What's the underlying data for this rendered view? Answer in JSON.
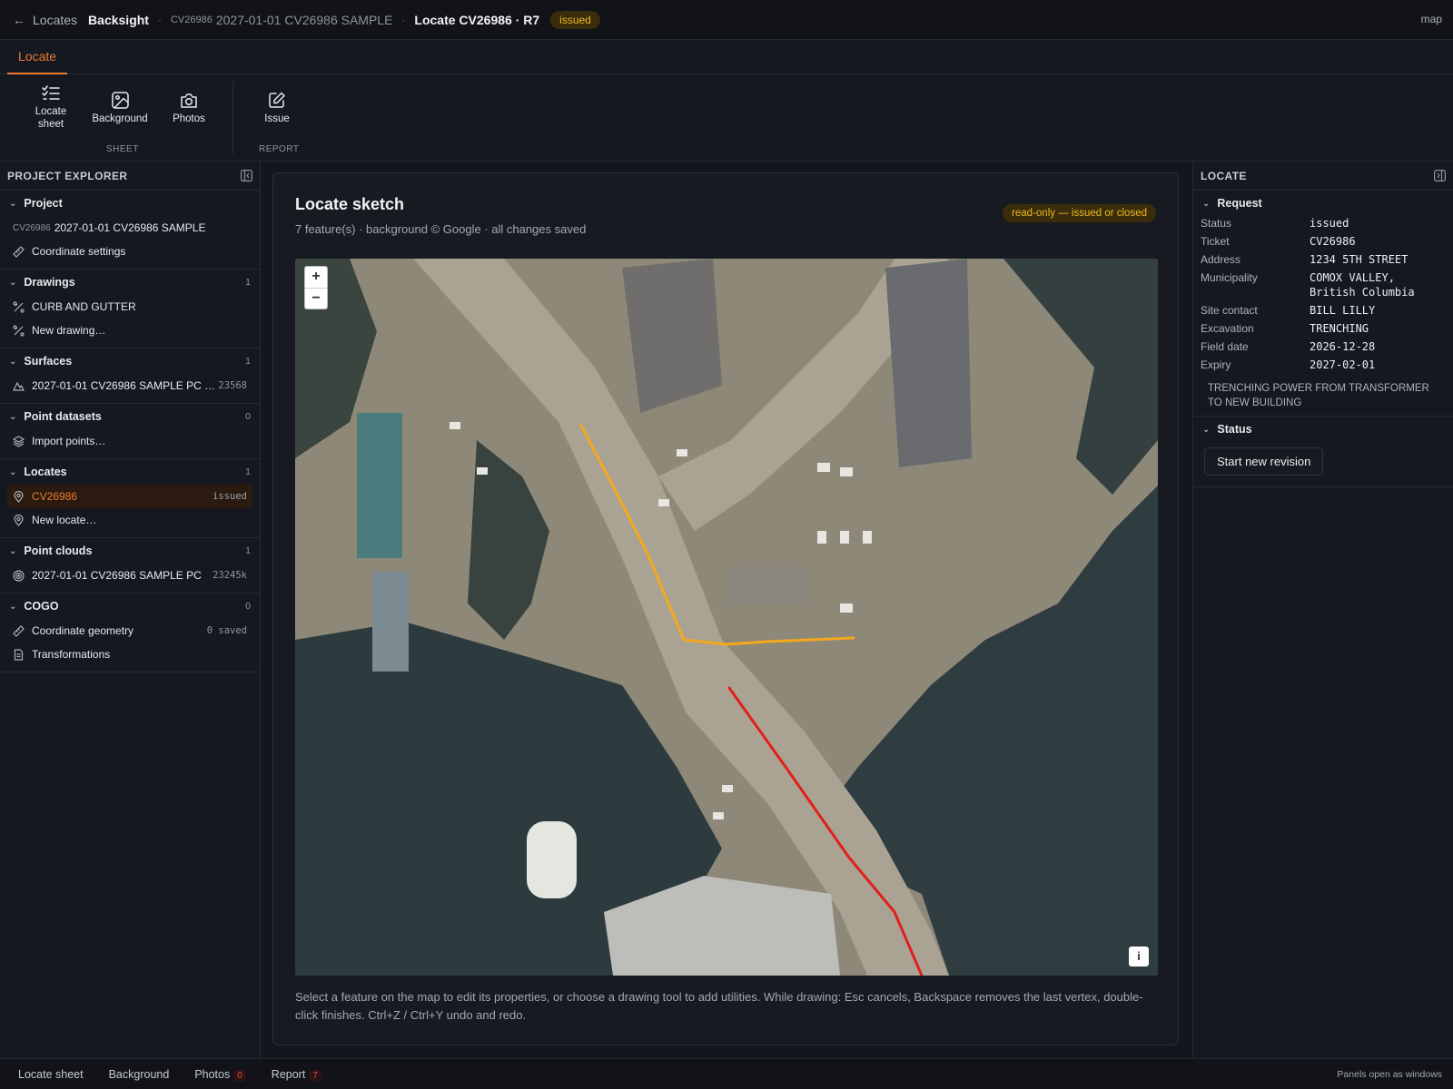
{
  "topbar": {
    "back_label": "Locates",
    "app_name": "Backsight",
    "project_id": "CV26986",
    "project_name": "2027-01-01 CV26986 SAMPLE",
    "locate_title": "Locate CV26986 · R7",
    "status_badge": "issued",
    "right_label": "map"
  },
  "ribbon": {
    "tab": "Locate",
    "buttons": {
      "locate_sheet": "Locate sheet",
      "background": "Background",
      "photos": "Photos",
      "issue": "Issue"
    },
    "groups": {
      "sheet": "SHEET",
      "report": "REPORT"
    }
  },
  "explorer": {
    "title": "PROJECT EXPLORER",
    "project": {
      "title": "Project",
      "id": "CV26986",
      "name": "2027-01-01 CV26986 SAMPLE",
      "coord_settings": "Coordinate settings"
    },
    "drawings": {
      "title": "Drawings",
      "count": "1",
      "items": [
        "CURB AND GUTTER",
        "New drawing…"
      ]
    },
    "surfaces": {
      "title": "Surfaces",
      "count": "1",
      "item": "2027-01-01 CV26986 SAMPLE PC …",
      "item_meta": "23568"
    },
    "point_datasets": {
      "title": "Point datasets",
      "count": "0",
      "item": "Import points…"
    },
    "locates": {
      "title": "Locates",
      "count": "1",
      "selected": "CV26986",
      "selected_meta": "issued",
      "new": "New locate…"
    },
    "point_clouds": {
      "title": "Point clouds",
      "count": "1",
      "item": "2027-01-01 CV26986 SAMPLE PC",
      "item_meta": "23245k"
    },
    "cogo": {
      "title": "COGO",
      "count": "0",
      "coord_geom": "Coordinate geometry",
      "coord_geom_meta": "0 saved",
      "transformations": "Transformations"
    }
  },
  "sketch": {
    "title": "Locate sketch",
    "subtitle": "7 feature(s) · background © Google · all changes saved",
    "readonly_badge": "read-only — issued or closed",
    "zoom_in": "+",
    "zoom_out": "−",
    "info": "i",
    "hint": "Select a feature on the map to edit its properties, or choose a drawing tool to add utilities. While drawing: Esc cancels, Backspace removes the last vertex, double-click finishes. Ctrl+Z / Ctrl+Y undo and redo.",
    "colors": {
      "gas_line": "#f5a81c",
      "power_line": "#e0201c"
    }
  },
  "locate_panel": {
    "title": "LOCATE",
    "request": {
      "title": "Request",
      "rows": [
        {
          "k": "Status",
          "v": "issued"
        },
        {
          "k": "Ticket",
          "v": "CV26986"
        },
        {
          "k": "Address",
          "v": "1234 5TH STREET"
        },
        {
          "k": "Municipality",
          "v": "COMOX VALLEY, British Columbia"
        },
        {
          "k": "Site contact",
          "v": "BILL LILLY"
        },
        {
          "k": "Excavation",
          "v": "TRENCHING"
        },
        {
          "k": "Field date",
          "v": "2026-12-28"
        },
        {
          "k": "Expiry",
          "v": "2027-02-01"
        }
      ],
      "description": "TRENCHING POWER FROM TRANSFORMER TO NEW BUILDING"
    },
    "status": {
      "title": "Status",
      "button": "Start new revision"
    }
  },
  "bottombar": {
    "tabs": {
      "locate_sheet": "Locate sheet",
      "background": "Background",
      "photos": "Photos",
      "photos_count": "0",
      "report": "Report",
      "report_count": "7"
    },
    "right": "Panels open as windows"
  }
}
